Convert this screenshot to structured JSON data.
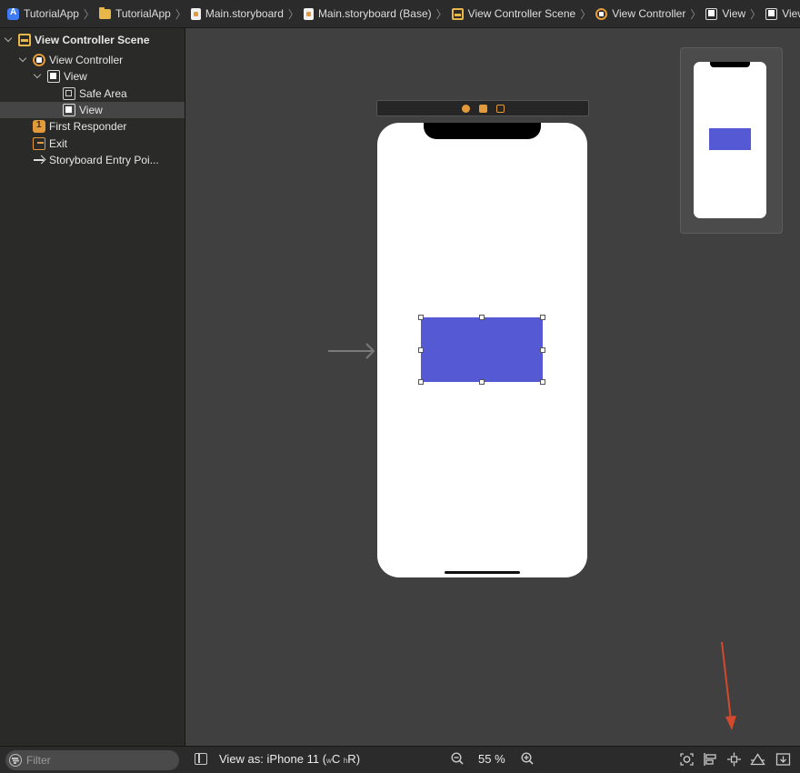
{
  "breadcrumb": [
    {
      "label": "TutorialApp",
      "icon": "xcode-project-icon"
    },
    {
      "label": "TutorialApp",
      "icon": "folder-icon"
    },
    {
      "label": "Main.storyboard",
      "icon": "storyboard-file-icon"
    },
    {
      "label": "Main.storyboard (Base)",
      "icon": "storyboard-file-icon"
    },
    {
      "label": "View Controller Scene",
      "icon": "scene-icon"
    },
    {
      "label": "View Controller",
      "icon": "view-controller-icon"
    },
    {
      "label": "View",
      "icon": "view-icon"
    },
    {
      "label": "View",
      "icon": "view-icon"
    }
  ],
  "outline": {
    "scene": "View Controller Scene",
    "view_controller": "View Controller",
    "view": "View",
    "safe_area": "Safe Area",
    "subview": "View",
    "first_responder": "First Responder",
    "exit": "Exit",
    "entry_point": "Storyboard Entry Poi..."
  },
  "bottom": {
    "filter_placeholder": "Filter",
    "view_as_prefix": "View as: iPhone 11 (",
    "trait_w": "w",
    "trait_c": "C",
    "trait_h": "h",
    "trait_r": "R",
    "view_as_suffix": ")",
    "zoom": "55 %"
  },
  "colors": {
    "canvas": "#404040",
    "sidebar": "#2a2a28",
    "selected_view": "#5659d4",
    "annotation_arrow": "#d2492d"
  }
}
